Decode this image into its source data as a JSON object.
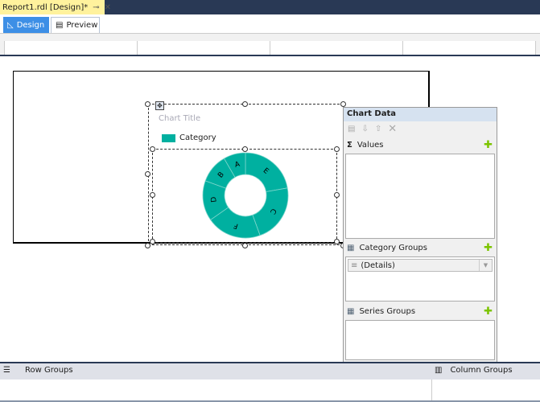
{
  "document_tab": {
    "title": "Report1.rdl [Design]*",
    "pin_icon": "⊸",
    "close_icon": "✕"
  },
  "view_tabs": [
    {
      "label": "Design",
      "active": true
    },
    {
      "label": "Preview",
      "active": false
    }
  ],
  "chart": {
    "title": "Chart Title",
    "legend_label": "Category",
    "color": "#00b0a0",
    "chart_data": {
      "type": "pie",
      "variant": "doughnut",
      "categories": [
        "E",
        "C",
        "F",
        "D",
        "B",
        "A"
      ],
      "values": [
        80,
        80,
        75,
        55,
        40,
        30
      ]
    }
  },
  "chart_data_panel": {
    "title": "Chart Data",
    "values_label": "Values",
    "category_groups_label": "Category Groups",
    "category_group_item": "(Details)",
    "series_groups_label": "Series Groups"
  },
  "grouping_pane": {
    "row_groups": "Row Groups",
    "column_groups": "Column Groups"
  }
}
